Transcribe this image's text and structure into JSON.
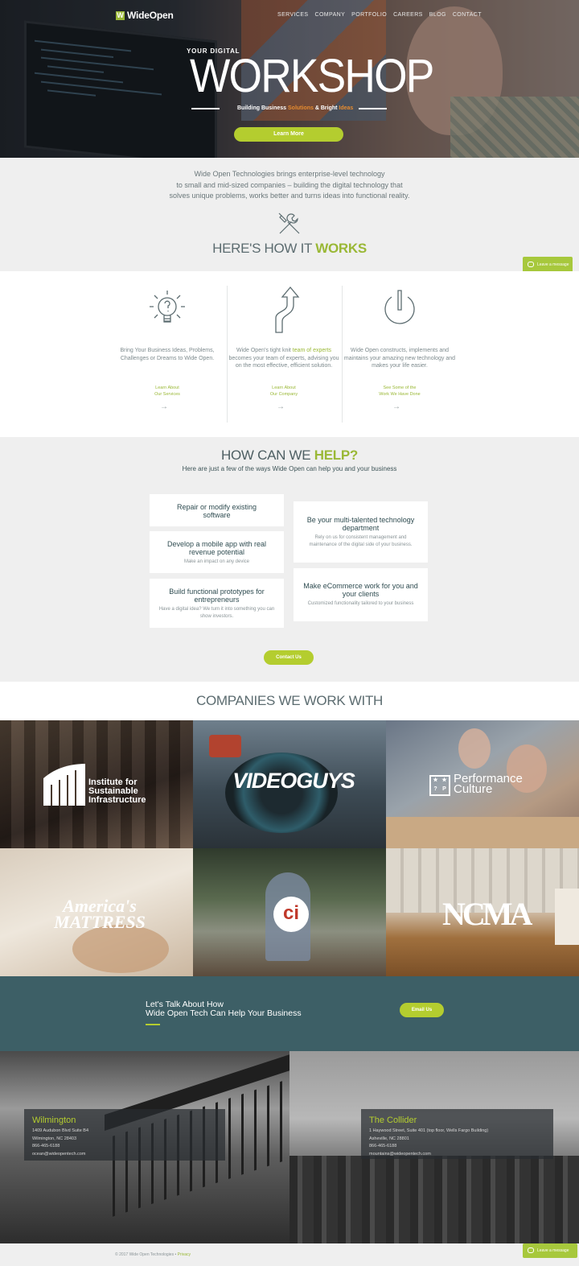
{
  "brand": {
    "logo_mark": "W",
    "logo_text": "WideOpen"
  },
  "nav": {
    "items": [
      "SERVICES",
      "COMPANY",
      "PORTFOLIO",
      "CAREERS",
      "BLOG",
      "CONTACT"
    ]
  },
  "hero": {
    "eyebrow": "YOUR DIGITAL",
    "title": "WORKSHOP",
    "tagline_a": "Building Business ",
    "tagline_b": "Solutions",
    "tagline_c": " & Bright ",
    "tagline_d": "Ideas",
    "button": "Learn More"
  },
  "intro": {
    "line1": "Wide Open Technologies brings enterprise-level technology",
    "line2": "to small and mid-sized companies – building the digital technology that",
    "line3": "solves unique problems, works better and turns ideas into functional reality.",
    "how_a": "HERE'S HOW IT ",
    "how_b": "WORKS"
  },
  "chat": {
    "label": "Leave a message"
  },
  "works": {
    "col1": {
      "text": "Bring Your Business Ideas, Problems, Challenges or Dreams to Wide Open.",
      "link1": "Learn About",
      "link2": "Our Services",
      "icon": "lightbulb-icon"
    },
    "col2": {
      "text_a": "Wide Open's tight knit ",
      "text_hl": "team of experts",
      "text_b": " becomes your team of experts, advising you on the most effective, efficient solution.",
      "link1": "Learn About",
      "link2": "Our Company",
      "icon": "road-arrow-icon"
    },
    "col3": {
      "text": "Wide Open constructs, implements and maintains your amazing new technology and makes your life easier.",
      "link1": "See Some of the",
      "link2": "Work We Have Done",
      "icon": "power-icon"
    }
  },
  "help": {
    "title_a": "HOW CAN WE ",
    "title_b": "HELP?",
    "subtitle": "Here are just a few of the ways Wide Open can help you and your business",
    "cards": [
      {
        "title": "Repair or modify existing software",
        "desc": ""
      },
      {
        "title": "Develop a mobile app with real revenue potential",
        "desc": "Make an impact on any device"
      },
      {
        "title": "Build functional prototypes for entrepreneurs",
        "desc": "Have a digital idea? We turn it into something you can show investors."
      },
      {
        "title": "Be your multi-talented technology department",
        "desc": "Rely on us for consistent management and maintenance of the digital side of your business."
      },
      {
        "title": "Make eCommerce work for you and your clients",
        "desc": "Customized functionality tailored to your business"
      }
    ],
    "button": "Contact Us"
  },
  "companies": {
    "title": "COMPANIES WE WORK WITH",
    "logos": [
      "Institute for Sustainable Infrastructure",
      "VIDEOGUYS",
      "Performance Culture",
      "America's MATTRESS",
      "ci",
      "NCMA"
    ]
  },
  "cta": {
    "line1": "Let's Talk About How",
    "line2": "Wide Open Tech Can Help Your Business",
    "button": "Email Us"
  },
  "offices": [
    {
      "name": "Wilmington",
      "lines": [
        "1409 Audubon Blvd Suite B4",
        "Wilmington, NC 28403",
        "866-465-6188",
        "ocean@wideopentech.com"
      ]
    },
    {
      "name": "The Collider",
      "lines": [
        "1 Haywood Street, Suite 401 (top floor, Wells Fargo Building)",
        "Asheville, NC 28801",
        "866-465-6188",
        "mountains@wideopentech.com"
      ]
    }
  ],
  "footer": {
    "copyright": "© 2017 Wide Open Technologies • ",
    "privacy": "Privacy"
  },
  "colors": {
    "accent": "#b4cd2f",
    "teal": "#3d5f66",
    "text": "#5a6a6e"
  }
}
